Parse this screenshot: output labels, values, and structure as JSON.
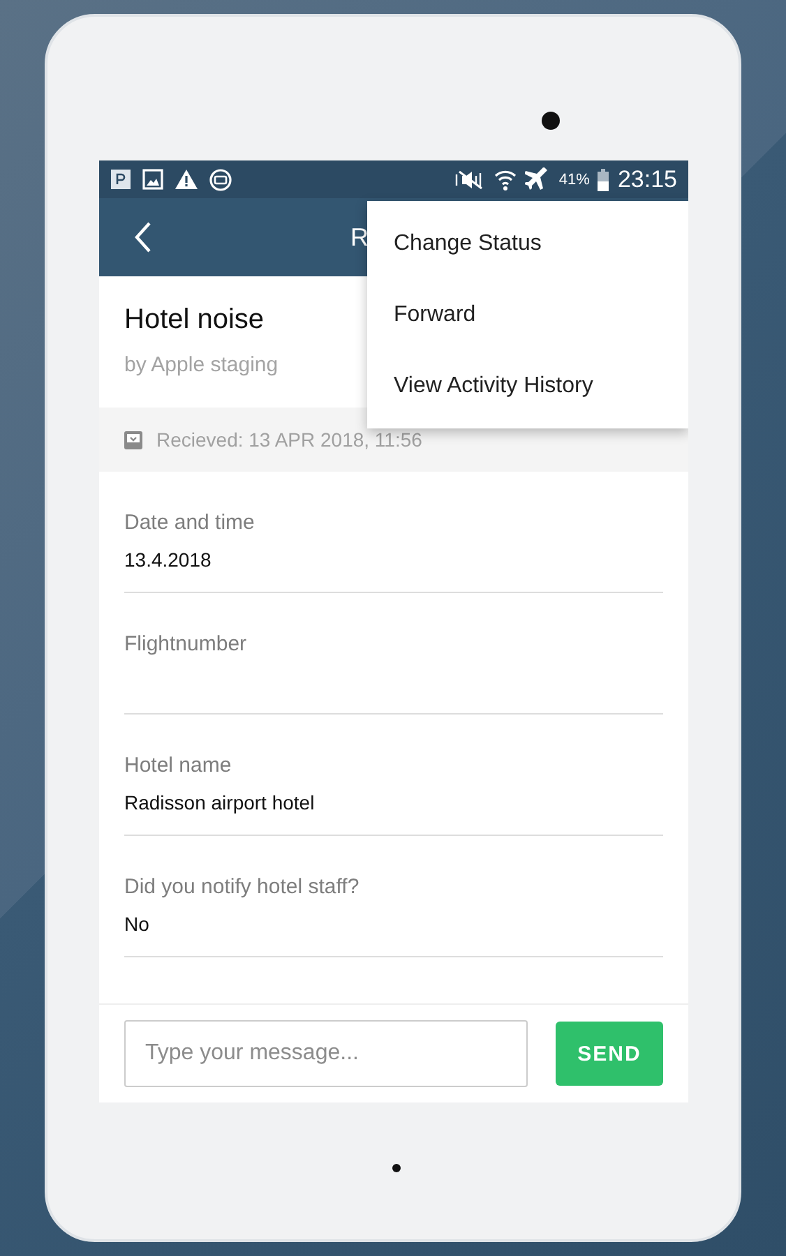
{
  "status_bar": {
    "battery": "41%",
    "time": "23:15"
  },
  "app_bar": {
    "title": "R"
  },
  "menu": {
    "items": [
      {
        "label": "Change Status"
      },
      {
        "label": "Forward"
      },
      {
        "label": "View Activity History"
      }
    ]
  },
  "report": {
    "title": "Hotel noise",
    "author": "by Apple staging",
    "received": "Recieved: 13 APR 2018, 11:56"
  },
  "fields": [
    {
      "label": "Date and time",
      "value": "13.4.2018"
    },
    {
      "label": "Flightnumber"
    },
    {
      "label": "Hotel name",
      "value": "Radisson airport hotel"
    },
    {
      "label": "Did you notify hotel staff?",
      "value": "No"
    }
  ],
  "composer": {
    "placeholder": "Type your message...",
    "button": "SEND"
  }
}
